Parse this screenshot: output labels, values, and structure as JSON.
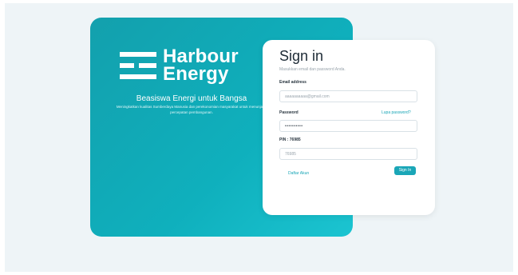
{
  "brand": {
    "name_line1": "Harbour",
    "name_line2": "Energy",
    "tagline": "Beasiswa Energi untuk Bangsa",
    "description": "Meningkatkan kualitas Sumberdaya Manusia dan perekonomian masyarakat untuk menunjang percepatan pembangunan."
  },
  "signin": {
    "title": "Sign in",
    "subtitle": "Masukkan email dan password Anda.",
    "email_label": "Email address",
    "email_value": "aaaaaaaaaa@gmail.com",
    "password_label": "Password",
    "forgot_link": "Lupa password?",
    "password_value": "••••••••••",
    "pin_label": "PIN : 76985",
    "pin_placeholder": "76985",
    "signup_link": "Daftar Akun",
    "submit_label": "Sign In"
  }
}
